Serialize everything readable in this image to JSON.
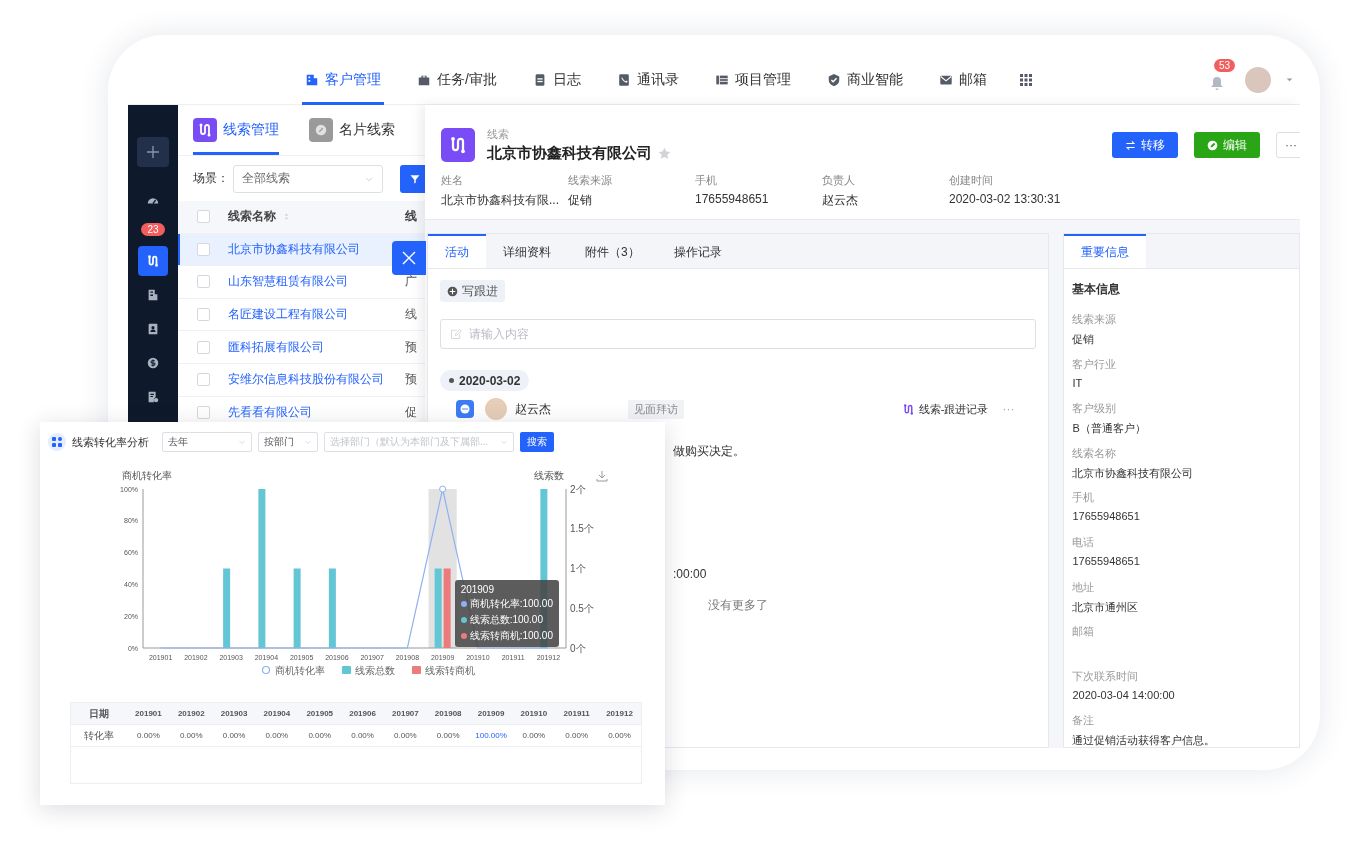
{
  "top_nav": {
    "items": [
      {
        "label": "客户管理",
        "selected": true
      },
      {
        "label": "任务/审批",
        "selected": false
      },
      {
        "label": "日志",
        "selected": false
      },
      {
        "label": "通讯录",
        "selected": false
      },
      {
        "label": "项目管理",
        "selected": false
      },
      {
        "label": "商业智能",
        "selected": false
      },
      {
        "label": "邮箱",
        "selected": false
      }
    ],
    "notification_count": "53"
  },
  "sidebar": {
    "badge": "23",
    "items": [
      {
        "selected": false
      },
      {
        "selected": true
      },
      {
        "selected": false
      },
      {
        "selected": false
      },
      {
        "selected": false
      },
      {
        "selected": false
      }
    ]
  },
  "list_panel": {
    "tabs": [
      {
        "label": "线索管理",
        "selected": true
      },
      {
        "label": "名片线索",
        "selected": false
      }
    ],
    "scene": {
      "label": "场景：",
      "value": "全部线索"
    },
    "all_checked": false,
    "columns": [
      "线索名称",
      "线"
    ],
    "rows": [
      {
        "name": "北京市协鑫科技有限公司",
        "selected": true,
        "checked": false
      },
      {
        "name": "山东智慧租赁有限公司",
        "column_2": "广",
        "selected": false,
        "checked": false
      },
      {
        "name": "名匠建设工程有限公司",
        "column_2": "线",
        "selected": false,
        "checked": false
      },
      {
        "name": "匯科拓展有限公司",
        "column_2": "预",
        "selected": false,
        "checked": false
      },
      {
        "name": "安维尔信息科技股份有限公司",
        "column_2": "预",
        "selected": false,
        "checked": false
      },
      {
        "name": "先看看有限公司",
        "column_2": "促",
        "selected": false,
        "checked": false
      }
    ]
  },
  "drawer": {
    "header": {
      "kind_label": "线索",
      "title": "北京市协鑫科技有限公司",
      "starred": false,
      "buttons": [
        {
          "label": "转移",
          "kind": "primary"
        },
        {
          "label": "编辑",
          "kind": "success"
        },
        {
          "label": "···",
          "kind": "more"
        }
      ],
      "fields": [
        {
          "label": "姓名",
          "value": "北京市协鑫科技有限..."
        },
        {
          "label": "线索来源",
          "value": "促销"
        },
        {
          "label": "手机",
          "value": "17655948651"
        },
        {
          "label": "负责人",
          "value": "赵云杰"
        },
        {
          "label": "创建时间",
          "value": "2020-03-02 13:30:31"
        }
      ]
    },
    "tabs": [
      {
        "label": "活动",
        "selected": true
      },
      {
        "label": "详细资料",
        "selected": false
      },
      {
        "label": "附件（3）",
        "selected": false
      },
      {
        "label": "操作记录",
        "selected": false
      }
    ],
    "activity": {
      "write_button": "写跟进",
      "input_placeholder": "请输入内容",
      "date": "2020-03-02",
      "entry": {
        "author": "赵云杰",
        "tag": "见面拜访",
        "source": "线索-跟进记录",
        "more": "···",
        "content": "做购买决定。",
        "time": ":00:00"
      },
      "end_text": "没有更多了"
    },
    "side_panel": {
      "tabs": [
        {
          "label": "重要信息",
          "selected": true
        }
      ],
      "section": "基本信息",
      "fields": [
        {
          "label": "线索来源",
          "value": "促销"
        },
        {
          "label": "客户行业",
          "value": "IT"
        },
        {
          "label": "客户级别",
          "value": "B（普通客户）"
        },
        {
          "label": "线索名称",
          "value": "北京市协鑫科技有限公司"
        },
        {
          "label": "手机",
          "value": "17655948651"
        },
        {
          "label": "电话",
          "value": "17655948651"
        },
        {
          "label": "地址",
          "value": "北京市通州区"
        },
        {
          "label": "邮箱"
        },
        {
          "label": "下次联系时间",
          "value": "2020-03-04 14:00:00"
        },
        {
          "label": "备注",
          "value": "通过促销活动获得客户信息。"
        }
      ]
    }
  },
  "chart_card": {
    "title": "线索转化率分析",
    "filters": [
      {
        "value": "去年"
      },
      {
        "value": "按部门"
      },
      {
        "placeholder": "选择部门（默认为本部门及下属部..."
      }
    ],
    "search_button": "搜索",
    "chart_data": {
      "type": "bar",
      "legend": "bottom",
      "ylabel": "商机转化率",
      "y2label": "线索数",
      "categories": [
        "201901",
        "201902",
        "201903",
        "201904",
        "201905",
        "201906",
        "201907",
        "201908",
        "201909",
        "201910",
        "201911",
        "201912"
      ],
      "series": [
        {
          "name": "商机转化率",
          "type": "line",
          "color": "#8fb0f0",
          "values": [
            0,
            0,
            0,
            0,
            0,
            0,
            0,
            0,
            100,
            0,
            0,
            0
          ]
        },
        {
          "name": "线索总数",
          "type": "bar",
          "axis": "y2",
          "color": "#63c6d4",
          "values": [
            0,
            0,
            1,
            2,
            1,
            1,
            0,
            0,
            1,
            0,
            0,
            2
          ]
        },
        {
          "name": "线索转商机",
          "type": "bar",
          "axis": "y2",
          "color": "#ec7c7c",
          "values": [
            0,
            0,
            0,
            0,
            0,
            0,
            0,
            0,
            1,
            0,
            0,
            0
          ]
        }
      ],
      "ylim": [
        0,
        100
      ],
      "yticks": [
        {
          "value": 0,
          "label": "0%"
        },
        {
          "value": 20,
          "label": "20%"
        },
        {
          "value": 40,
          "label": "40%"
        },
        {
          "value": 60,
          "label": "60%"
        },
        {
          "value": 80,
          "label": "80%"
        },
        {
          "value": 100,
          "label": "100%"
        }
      ],
      "y2lim": [
        0,
        2
      ],
      "y2ticks": [
        {
          "value": 0,
          "label": "0个"
        },
        {
          "value": 0.5,
          "label": "0.5个"
        },
        {
          "value": 1,
          "label": "1个"
        },
        {
          "value": 1.5,
          "label": "1.5个"
        },
        {
          "value": 2,
          "label": "2个"
        }
      ]
    },
    "tooltip": {
      "title": "201909",
      "items": [
        {
          "text": "商机转化率:100.00",
          "color": "#8fb0f0"
        },
        {
          "text": "线索总数:100.00",
          "color": "#63c6d4"
        },
        {
          "text": "线索转商机:100.00",
          "color": "#ec7c7c"
        }
      ]
    },
    "table": {
      "columns": [
        "日期",
        "201901",
        "201902",
        "201903",
        "201904",
        "201905",
        "201906",
        "201907",
        "201908",
        "201909",
        "201910",
        "201911",
        "201912"
      ],
      "rows": [
        {
          "cells": [
            {
              "text": "转化率",
              "kind": "label"
            },
            {
              "text": "0.00%",
              "kind": "text"
            },
            {
              "text": "0.00%",
              "kind": "text"
            },
            {
              "text": "0.00%",
              "kind": "text"
            },
            {
              "text": "0.00%",
              "kind": "text"
            },
            {
              "text": "0.00%",
              "kind": "text"
            },
            {
              "text": "0.00%",
              "kind": "text"
            },
            {
              "text": "0.00%",
              "kind": "text"
            },
            {
              "text": "0.00%",
              "kind": "text"
            },
            {
              "text": "100.00%",
              "kind": "link"
            },
            {
              "text": "0.00%",
              "kind": "text"
            },
            {
              "text": "0.00%",
              "kind": "text"
            },
            {
              "text": "0.00%",
              "kind": "text"
            }
          ]
        }
      ]
    }
  }
}
